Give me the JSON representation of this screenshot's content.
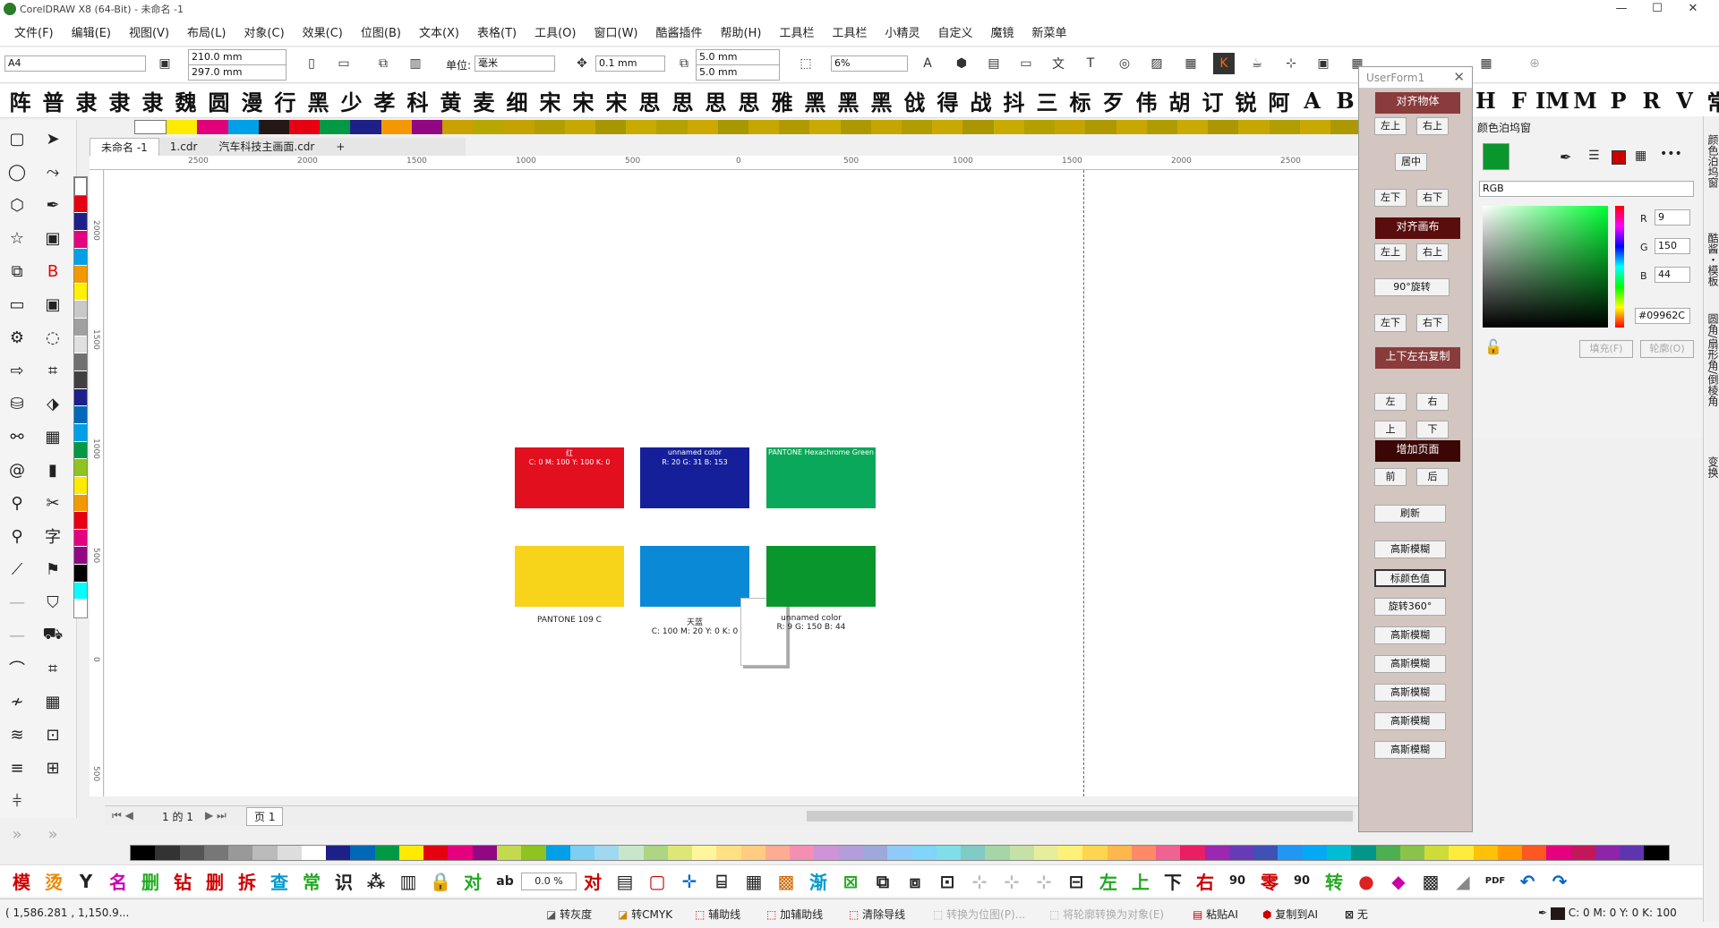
{
  "window": {
    "title": "CorelDRAW X8 (64-Bit) - 未命名 -1",
    "min": "—",
    "max": "☐",
    "close": "✕"
  },
  "menu": [
    "文件(F)",
    "编辑(E)",
    "视图(V)",
    "布局(L)",
    "对象(C)",
    "效果(C)",
    "位图(B)",
    "文本(X)",
    "表格(T)",
    "工具(O)",
    "窗口(W)",
    "酷酱插件",
    "帮助(H)",
    "工具栏",
    "工具栏",
    "小精灵",
    "自定义",
    "魔镜",
    "新菜单"
  ],
  "propbar": {
    "page_size": "A4",
    "width": "210.0 mm",
    "height": "297.0 mm",
    "unit_label": "单位:",
    "unit": "毫米",
    "nudge": "0.1 mm",
    "dup_x": "5.0 mm",
    "dup_y": "5.0 mm",
    "zoom": "6%"
  },
  "fontbar": [
    "阵",
    "普",
    "隶",
    "隶",
    "隶",
    "魏",
    "圆",
    "漫",
    "行",
    "黑",
    "少",
    "孝",
    "科",
    "黄",
    "麦",
    "细",
    "宋",
    "宋",
    "宋",
    "思",
    "思",
    "思",
    "思",
    "雅",
    "黑",
    "黑",
    "黑",
    "戗",
    "得",
    "战",
    "抖",
    "三",
    "标",
    "歹",
    "伟",
    "胡",
    "订",
    "锐",
    "阿",
    "A",
    "B",
    "H",
    "F",
    "IM",
    "M",
    "P",
    "R",
    "V",
    "常"
  ],
  "doc_tabs": [
    "未命名 -1",
    "1.cdr",
    "汽车科技主画面.cdr",
    "+"
  ],
  "rulers": {
    "h_ticks": [
      "2500",
      "2000",
      "1500",
      "1000",
      "500",
      "0",
      "500",
      "1000",
      "1500",
      "2000",
      "2500"
    ],
    "v_ticks": [
      "2000",
      "1500",
      "1000",
      "500",
      "0",
      "500"
    ]
  },
  "swatches": [
    {
      "color": "#e20f1f",
      "text_top": "红",
      "text_bottom": "C: 0 M: 100 Y: 100 K: 0",
      "caption": ""
    },
    {
      "color": "#141f99",
      "text_top": "unnamed color",
      "text_bottom": "R: 20 G: 31 B: 153",
      "caption": ""
    },
    {
      "color": "#0aa85a",
      "text_top": "PANTONE Hexachrome Green",
      "text_bottom": "",
      "caption": ""
    },
    {
      "color": "#f7d31a",
      "text_top": "",
      "text_bottom": "",
      "caption": "PANTONE 109 C"
    },
    {
      "color": "#0a8ad6",
      "text_top": "",
      "text_bottom": "",
      "caption": "天蓝\nC: 100 M: 20 Y: 0 K: 0"
    },
    {
      "color": "#09962c",
      "text_top": "",
      "text_bottom": "",
      "caption": "unnamed color\nR: 9 G: 150 B: 44"
    }
  ],
  "pagebar": {
    "page_count": "1 的 1",
    "page_tab": "页 1"
  },
  "userform": {
    "title": "UserForm1",
    "close": "✕",
    "headers": [
      "对齐物体",
      "对齐画布",
      "上下左右复制",
      "增加页面"
    ],
    "buttons": [
      "左上",
      "右上",
      "居中",
      "左下",
      "右下",
      "左上",
      "右上",
      "90°旋转",
      "左下",
      "右下",
      "左",
      "右",
      "上",
      "下",
      "前",
      "后",
      "刷新",
      "高斯模糊",
      "标颜色值",
      "旋转360°",
      "高斯模糊",
      "高斯模糊",
      "高斯模糊",
      "高斯模糊",
      "高斯模糊"
    ]
  },
  "color_docker": {
    "title": "颜色泊坞窗",
    "model": "RGB",
    "r_label": "R",
    "r": "9",
    "g_label": "G",
    "g": "150",
    "b_label": "B",
    "b": "44",
    "hex": "#09962C",
    "fill_btn": "填充(F)",
    "outline_btn": "轮廓(O)",
    "current": "#09962c"
  },
  "dock_tabs": [
    "颜色泊坞窗",
    "酷酱・模板",
    "圆角/扇形角/倒棱角",
    "变换"
  ],
  "bottom_tools": [
    "模",
    "烫",
    "Y",
    "名",
    "删",
    "钻",
    "删",
    "拆",
    "查",
    "常",
    "识",
    "⁂",
    "▥",
    "🔒",
    "对",
    "ab",
    "0.0 %",
    "对",
    "▤",
    "▢",
    "✛",
    "⌸",
    "▦",
    "▩",
    "渐",
    "⊠",
    "⧉",
    "⧈",
    "⊡",
    "⊹",
    "⊹",
    "⊹",
    "⊟",
    "左",
    "上",
    "下",
    "右",
    "90",
    "零",
    "90",
    "转",
    "●",
    "◆",
    "▩",
    "◢",
    "PDF",
    "↶",
    "↷"
  ],
  "status": {
    "coords": "( 1,586.281 , 1,150.9...",
    "items": [
      "转灰度",
      "转CMYK",
      "辅助线",
      "加辅助线",
      "清除导线",
      "转换为位图(P)...",
      "将轮廓转换为对象(E)",
      "粘贴AI",
      "复制到AI",
      "无"
    ],
    "fill_info": "C: 0 M: 0 Y: 0 K: 100"
  }
}
